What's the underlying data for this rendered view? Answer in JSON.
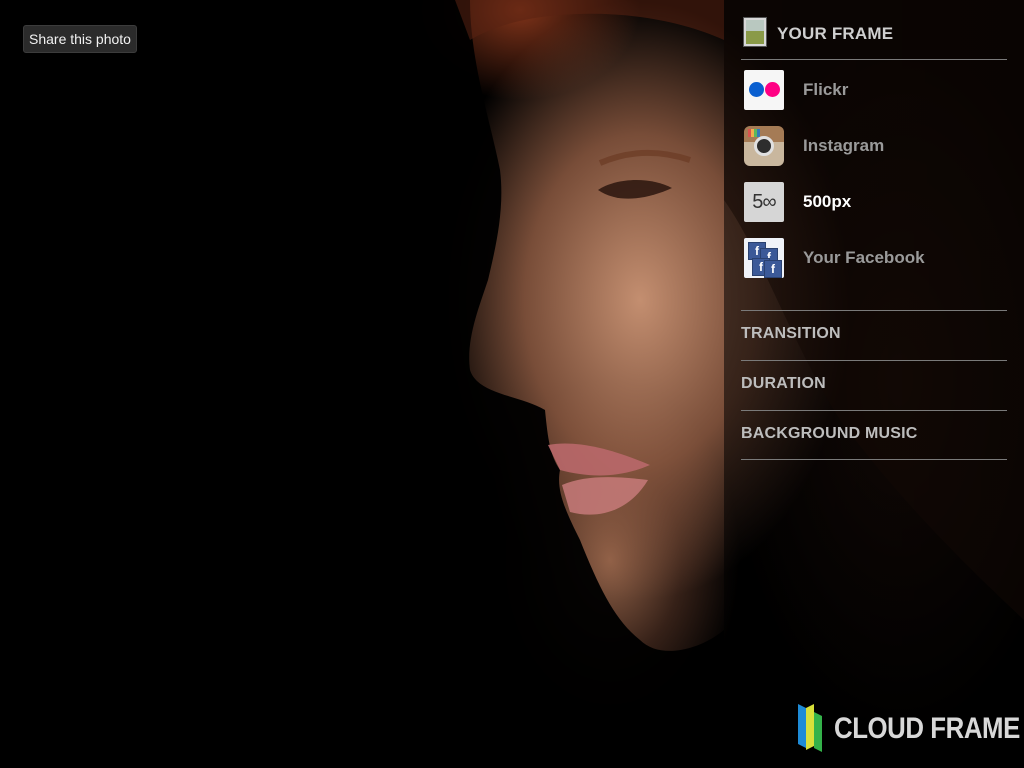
{
  "share_button": {
    "label": "Share this photo"
  },
  "panel": {
    "frame_title": "YOUR FRAME",
    "sources": [
      {
        "label": "Flickr",
        "icon": "flickr-icon",
        "active": false
      },
      {
        "label": "Instagram",
        "icon": "instagram-icon",
        "active": false
      },
      {
        "label": "500px",
        "icon": "500px-icon",
        "active": true
      },
      {
        "label": "Your Facebook",
        "icon": "facebook-icon",
        "active": false
      }
    ],
    "menu": [
      {
        "label": "TRANSITION"
      },
      {
        "label": "DURATION"
      },
      {
        "label": "BACKGROUND MUSIC"
      }
    ]
  },
  "brand": {
    "name": "CLOUD FRAME"
  },
  "icons": {
    "icon_500_text": "5∞"
  },
  "colors": {
    "panel_text": "#bdbdbd",
    "active_text": "#ffffff",
    "inactive_text": "#9a9a9a",
    "divider": "#7a7a7a",
    "flickr_blue": "#0a5fd0",
    "flickr_pink": "#ff0084",
    "logo_blue": "#1e8bd6",
    "logo_yellow": "#d8e03a",
    "logo_green": "#34b24a"
  }
}
